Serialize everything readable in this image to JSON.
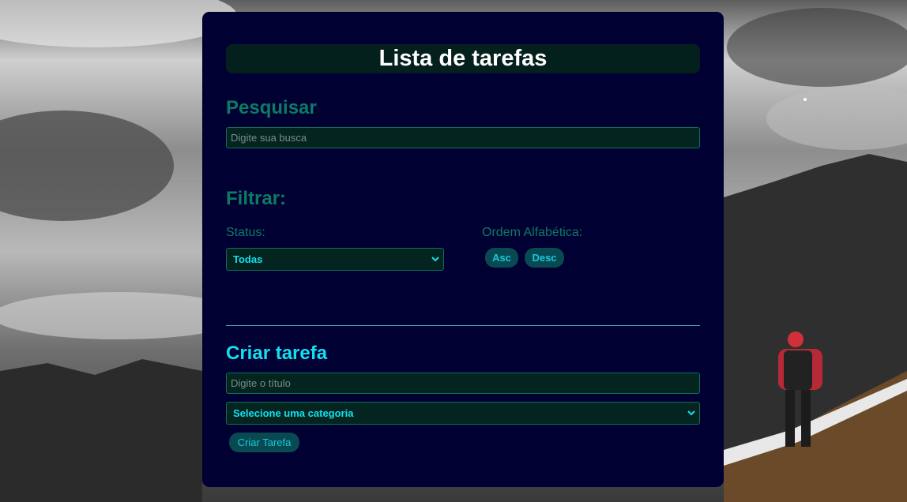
{
  "app": {
    "title": "Lista de tarefas"
  },
  "search": {
    "heading": "Pesquisar",
    "placeholder": "Digite sua busca",
    "value": ""
  },
  "filter": {
    "heading": "Filtrar:",
    "status_label": "Status:",
    "status_selected": "Todas",
    "order_label": "Ordem Alfabética:",
    "asc_label": "Asc",
    "desc_label": "Desc"
  },
  "create": {
    "heading": "Criar tarefa",
    "title_placeholder": "Digite o título",
    "title_value": "",
    "category_selected": "Selecione uma categoria",
    "submit_label": "Criar Tarefa"
  },
  "colors": {
    "card_bg": "#000033",
    "title_bar_bg": "#04201c",
    "heading_green": "#0c7b63",
    "accent_cyan": "#13e0ef",
    "button_bg": "#094a52"
  },
  "icons": {
    "select_chevron": "chevron-down-icon"
  }
}
